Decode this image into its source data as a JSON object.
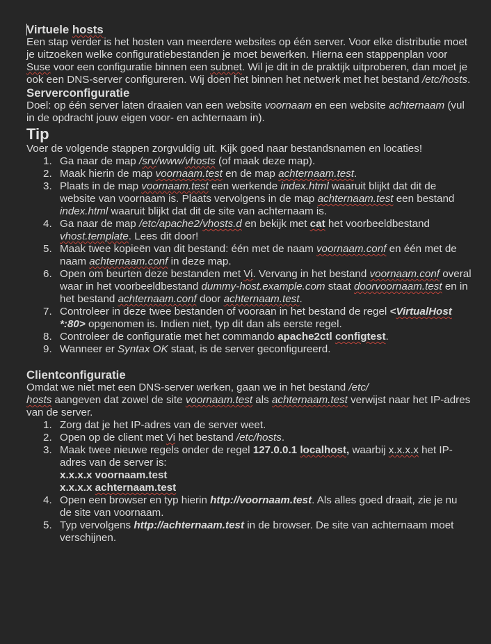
{
  "doc": {
    "title_part1": "Virtuele ",
    "title_part2": "hosts",
    "intro": {
      "t1": "Een stap verder is het hosten van meerdere websites op één server. Voor elke distributie moet je uitzoeken welke configuratiebestanden je moet bewerken. Hierna een stappenplan voor ",
      "suse": "Suse",
      "t2": " voor een configuratie binnen een ",
      "subnet": "subnet",
      "t3": ". Wil je dit in de praktijk uitproberen, dan moet je ook een DNS-server configureren. Wij doen het binnen het netwerk met het bestand ",
      "path": "/etc/hosts",
      "t4": "."
    },
    "server": {
      "heading": "Serverconfiguratie",
      "t1": "Doel: op één server laten draaien van een website ",
      "voornaam": "voornaam",
      "t2": " en een website ",
      "achternaam": "achternaam",
      "t3": " (vul in de opdracht jouw eigen voor- en achternaam in)."
    },
    "tip": {
      "heading": "Tip",
      "intro": "Voer de volgende stappen zorgvuldig uit. Kijk goed naar bestandsnamen en locaties!"
    },
    "steps": {
      "s1": {
        "num": "1.",
        "a": "Ga naar de map ",
        "p1": "/",
        "p2": "srv",
        "p3": "/www/",
        "p4": "vhosts",
        "b": " (of maak deze map)."
      },
      "s2": {
        "num": "2.",
        "a": "Maak hierin de map ",
        "f1": "voornaam.test",
        "b": " en de map ",
        "f2": "achternaam.test",
        "c": "."
      },
      "s3": {
        "num": "3.",
        "a": "Plaats in de map ",
        "f1": "voornaam.test",
        "b": " een werkende ",
        "f2": "index.html",
        "c": " waaruit blijkt dat dit de website van voornaam is. Plaats vervolgens in de map ",
        "f3": "achternaam.test",
        "d": " een bestand ",
        "f4": "index.html",
        "e": " waaruit blijkt dat dit de site van achternaam is."
      },
      "s4": {
        "num": "4.",
        "a": "Ga naar de map ",
        "p1": "/etc/apache2/",
        "p2": "vhosts.d",
        "b": " en bekijk met ",
        "cmd": "cat",
        "c": " het voorbeeldbestand ",
        "f1": "vhost.template",
        "d": ". Lees dit door!"
      },
      "s5": {
        "num": "5.",
        "a": "Maak twee kopieën van dit bestand: één met de naam ",
        "f1": "voornaam.conf",
        "b": " en één met de naam ",
        "f2": "achternaam.conf",
        "c": " in deze map."
      },
      "s6": {
        "num": "6.",
        "a": "Open om beurten deze bestanden met ",
        "vi": "Vi",
        "b": ". Vervang in het bestand ",
        "f1": "voornaam.conf",
        "c": " overal waar in het voorbeeldbestand ",
        "d1": "dummy-host.example.com",
        "d": " staat ",
        "door": "doorvoornaam.test",
        "e": " en in het bestand ",
        "f2": "achternaam.conf",
        "f": " door ",
        "f3": "achternaam.test",
        "g": "."
      },
      "s7": {
        "num": "7.",
        "a": "Controleer in deze twee bestanden of vooraan in het bestand de regel ",
        "tag1": "<",
        "tag2": "VirtualHost",
        "tag3": " *:80>",
        "b": " opgenomen is. Indien niet, typ dit dan als eerste regel."
      },
      "s8": {
        "num": "8.",
        "a": "Controleer de configuratie met het commando ",
        "c1": "apache2ctl ",
        "c2": "configtest",
        "b": "."
      },
      "s9": {
        "num": "9.",
        "a": "Wanneer er ",
        "ok": "Syntax OK",
        "b": " staat, is de server geconfigureerd."
      }
    },
    "client": {
      "heading": "Clientconfiguratie",
      "t1": "Omdat we niet met een DNS-server werken, gaan we in het bestand ",
      "p1": "/etc/",
      "p2": "hosts",
      "t2": " aangeven dat zowel de site ",
      "f1": "voornaam.test",
      "t3": " als ",
      "f2": "achternaam.test",
      "t4": " verwijst naar het IP-adres van de server."
    },
    "csteps": {
      "c1": {
        "num": "1.",
        "text": "Zorg dat je het IP-adres van de server weet."
      },
      "c2": {
        "num": "2.",
        "a": "Open op de client met ",
        "vi": "Vi",
        "b": " het bestand ",
        "path": "/etc/hosts",
        "c": "."
      },
      "c3": {
        "num": "3.",
        "a": "Maak twee nieuwe regels onder de regel ",
        "ip": "127.0.0.1 ",
        "lh": "localhost",
        "comma": ",",
        "b": " waarbij ",
        "xx": "x.x.x.x",
        "c": " het IP-adres van de server is:",
        "l1": "x.x.x.x voornaam.test",
        "l2a": "x.x.x.x ",
        "l2b": "achternaam.test"
      },
      "c4": {
        "num": "4.",
        "a": "Open een browser en typ hierin ",
        "url": "http://voornaam.test",
        "b": ". Als alles goed draait, zie je nu de site van voornaam."
      },
      "c5": {
        "num": "5.",
        "a": "Typ vervolgens ",
        "url": "http://achternaam.test",
        "b": " in de browser. De site van achternaam moet verschijnen."
      }
    }
  }
}
